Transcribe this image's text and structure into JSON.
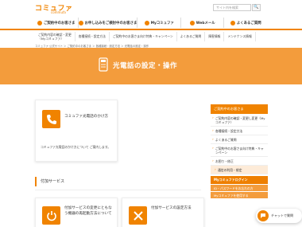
{
  "header": {
    "logo": "コミュファ",
    "logo_sub": "commufa",
    "search_placeholder": "サイト内を検索",
    "search_button": "🔍",
    "gnav": [
      {
        "label": "ご契約中のお客さま"
      },
      {
        "label": "お申し込みをご検討中のお客さま"
      },
      {
        "label": "Myコミュファ"
      },
      {
        "label": "Webメール"
      },
      {
        "label": "よくあるご質問"
      }
    ]
  },
  "subnav": {
    "first_line1": "ご契約内容の確認・変更",
    "first_line2": "（Myコミュファ）",
    "items": [
      "各種接続・設定方法",
      "ご契約中のお客さま向け特典・キャンペーン",
      "よくあるご質問",
      "障害情報",
      "メンテナンス情報"
    ]
  },
  "breadcrumb": "コミュファ 公式サイト ＞ ご契約中のお客さま ＞ 各種接続・設定方法 ＞ 光電話の設定・操作",
  "hero": {
    "title": "光電話の設定・操作"
  },
  "main_card": {
    "title": "コミュファ光電話のかけ方",
    "desc": "コミュファ光電話のかけ方について ご案内します。"
  },
  "section": {
    "title": "付加サービス"
  },
  "cards": [
    {
      "title": "付加サービスの変更にともなう機器の再起動方法について"
    },
    {
      "title": "付加サービスの設定方法"
    }
  ],
  "sidebar": {
    "head": "ご契約中のお客さま",
    "items": [
      {
        "label": "ご契約内容の確認・変更し変更（Myコミュファ）",
        "type": "item"
      },
      {
        "label": "各種接続・設定方法",
        "type": "item"
      },
      {
        "label": "よくあるご質問",
        "type": "item"
      },
      {
        "label": "ご契約中のお客さま向け特典・キャンペーン",
        "type": "item"
      },
      {
        "label": "お困り・修正",
        "type": "item"
      },
      {
        "label": "通信の利用・規定",
        "type": "sub"
      }
    ],
    "my_link": "Myコミュファログイン",
    "sub_links": [
      "ID・パスワードをお忘れの方",
      "Myコミュファを使用する"
    ]
  },
  "chat": {
    "label": "チャットで質問"
  },
  "colors": {
    "brand": "#f08300",
    "hero": "#f39c3c"
  }
}
